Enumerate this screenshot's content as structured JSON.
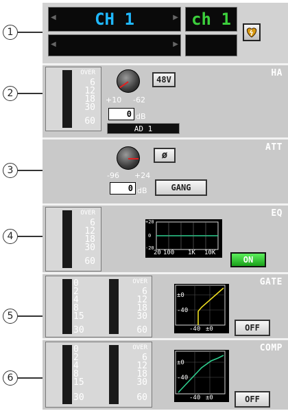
{
  "callouts": [
    "1",
    "2",
    "3",
    "4",
    "5",
    "6"
  ],
  "channel": {
    "name": "CH 1",
    "short_name": "ch 1",
    "left_arrow": "◀",
    "right_arrow": "▶",
    "icon": "heart-icon"
  },
  "ha": {
    "title": "HA",
    "meter_scale": [
      "OVER",
      "6",
      "12",
      "18",
      "30",
      "60"
    ],
    "phantom_label": "48V",
    "gain_max_label": "+10",
    "gain_min_label": "-62",
    "gain_value": "0",
    "unit": "dB",
    "input_patch": "AD 1"
  },
  "att": {
    "title": "ATT",
    "min_label": "-96",
    "max_label": "+24",
    "value": "0",
    "unit": "dB",
    "phase_label": "ø",
    "gang_label": "GANG"
  },
  "eq": {
    "title": "EQ",
    "meter_scale": [
      "OVER",
      "6",
      "12",
      "18",
      "30",
      "60"
    ],
    "graph_y_labels": [
      "+20",
      "0",
      "-20"
    ],
    "graph_x_labels": [
      "20",
      "100",
      "1K",
      "10K"
    ],
    "on_label": "ON"
  },
  "gate": {
    "title": "GATE",
    "reduction_scale": [
      "0",
      "2",
      "4",
      "8",
      "15",
      "30"
    ],
    "level_scale": [
      "OVER",
      "6",
      "12",
      "18",
      "30",
      "60"
    ],
    "graph_y_labels": [
      "±0",
      "-40"
    ],
    "graph_x_labels": [
      "-40",
      "±0"
    ],
    "off_label": "OFF"
  },
  "comp": {
    "title": "COMP",
    "reduction_scale": [
      "0",
      "2",
      "4",
      "8",
      "15",
      "30"
    ],
    "level_scale": [
      "OVER",
      "6",
      "12",
      "18",
      "30",
      "60"
    ],
    "graph_y_labels": [
      "±0",
      "-40"
    ],
    "graph_x_labels": [
      "-40",
      "±0"
    ],
    "off_label": "OFF"
  },
  "colors": {
    "panel": "#c9c9c9",
    "channel_name": "#1fb8ff",
    "short_name": "#3ccf3c",
    "eq_curve": "#2ecf8f",
    "gate_curve": "#f0e020",
    "comp_curve": "#2ecf8f",
    "knob_pointer": "#e02020"
  }
}
